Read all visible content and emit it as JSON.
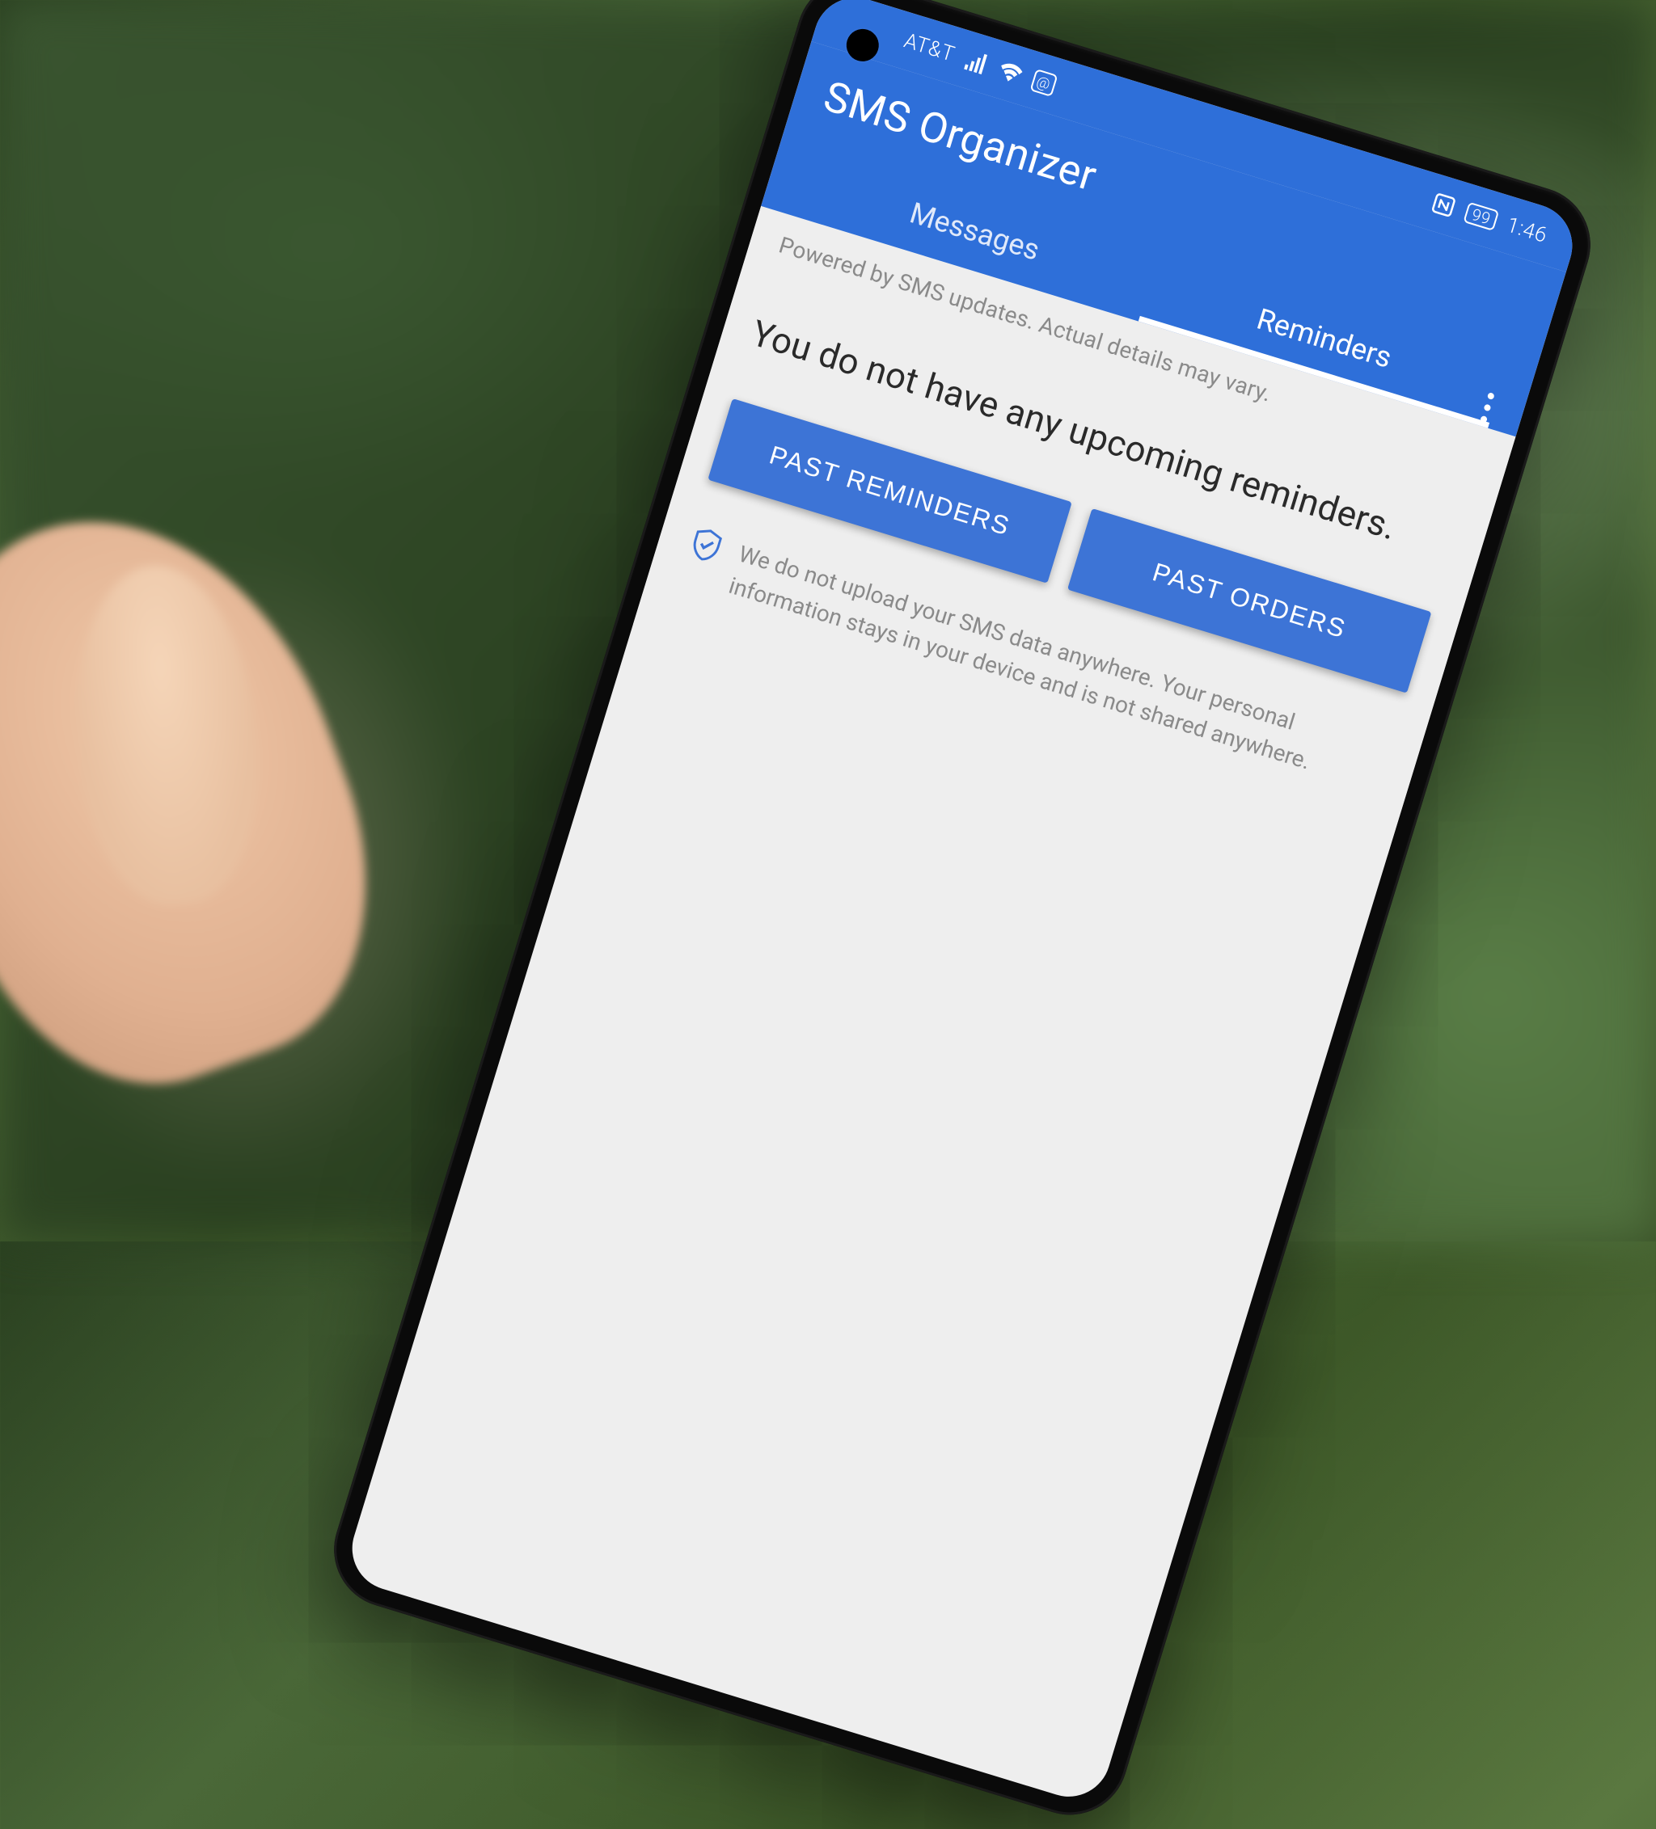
{
  "status": {
    "carrier": "AT&T",
    "battery": "99",
    "time": "1:46"
  },
  "header": {
    "title": "SMS Organizer"
  },
  "tabs": {
    "messages": "Messages",
    "reminders": "Reminders"
  },
  "content": {
    "powered": "Powered by SMS updates. Actual details may vary.",
    "empty": "You do not have any upcoming reminders.",
    "past_reminders": "PAST REMINDERS",
    "past_orders": "PAST ORDERS",
    "privacy": "We do not upload your SMS data anywhere. Your personal information stays in your device and is not shared anywhere."
  }
}
